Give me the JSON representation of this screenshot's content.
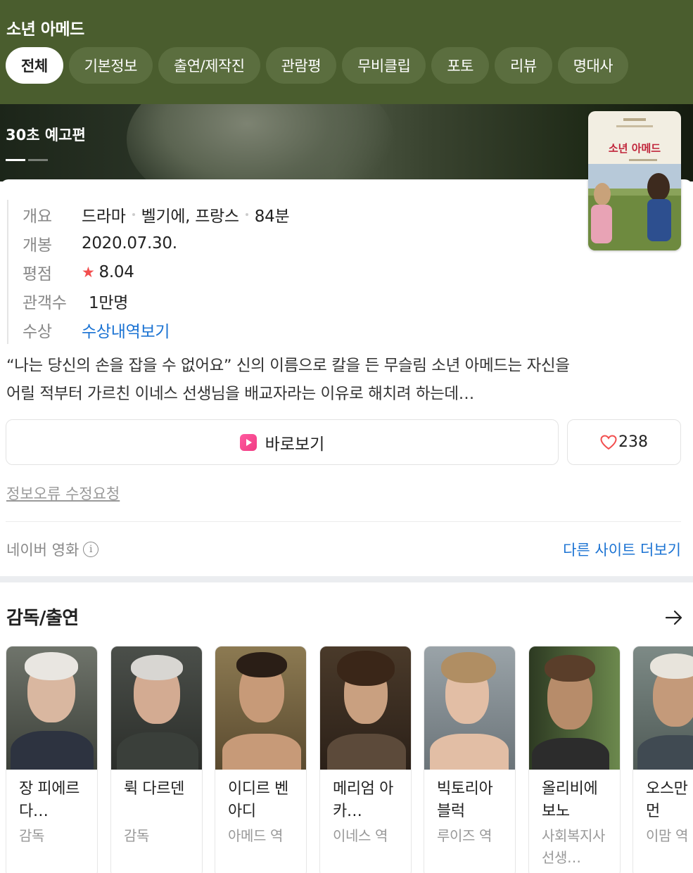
{
  "header": {
    "title": "소년 아메드",
    "tabs": [
      {
        "label": "전체",
        "active": true
      },
      {
        "label": "기본정보",
        "active": false
      },
      {
        "label": "출연/제작진",
        "active": false
      },
      {
        "label": "관람평",
        "active": false
      },
      {
        "label": "무비클립",
        "active": false
      },
      {
        "label": "포토",
        "active": false
      },
      {
        "label": "리뷰",
        "active": false
      },
      {
        "label": "명대사",
        "active": false
      }
    ]
  },
  "trailer": {
    "label": "30초 예고편"
  },
  "poster": {
    "title_text": "소년 아메드"
  },
  "info": {
    "overview_label": "개요",
    "genre": "드라마",
    "country": "벨기에, 프랑스",
    "runtime": "84분",
    "release_label": "개봉",
    "release_date": "2020.07.30.",
    "rating_label": "평점",
    "rating": "8.04",
    "audience_label": "관객수",
    "audience": "1만명",
    "award_label": "수상",
    "award_link": "수상내역보기"
  },
  "synopsis": {
    "line1": "“나는 당신의 손을 잡을 수 없어요” 신의 이름으로 칼을 든 무슬림 소년 아메드는 자신을",
    "line2": "어릴 적부터 가르친 이네스 선생님을 배교자라는 이유로 해치려 하는데…"
  },
  "actions": {
    "watch_label": "바로보기",
    "like_count": "238"
  },
  "footer": {
    "report_link": "정보오류 수정요청",
    "source": "네이버 영화",
    "more_sites": "다른 사이트 더보기"
  },
  "cast_section": {
    "title": "감독/출연",
    "people": [
      {
        "name": "장 피에르 다…",
        "role": "감독"
      },
      {
        "name": "뤽 다르덴",
        "role": "감독"
      },
      {
        "name": "이디르 벤 아디",
        "role": "아메드 역"
      },
      {
        "name": "메리엄 아카…",
        "role": "이네스 역"
      },
      {
        "name": "빅토리아 블럭",
        "role": "루이즈 역"
      },
      {
        "name": "올리비에 보노",
        "role": "사회복지사 선생…"
      },
      {
        "name": "오스만 모먼",
        "role": "이맘 역"
      }
    ]
  },
  "colors": {
    "header_bg": "#4a5d2e",
    "link": "#1b73d3",
    "star": "#f24e4e",
    "watch_icon": "#f03b82"
  }
}
